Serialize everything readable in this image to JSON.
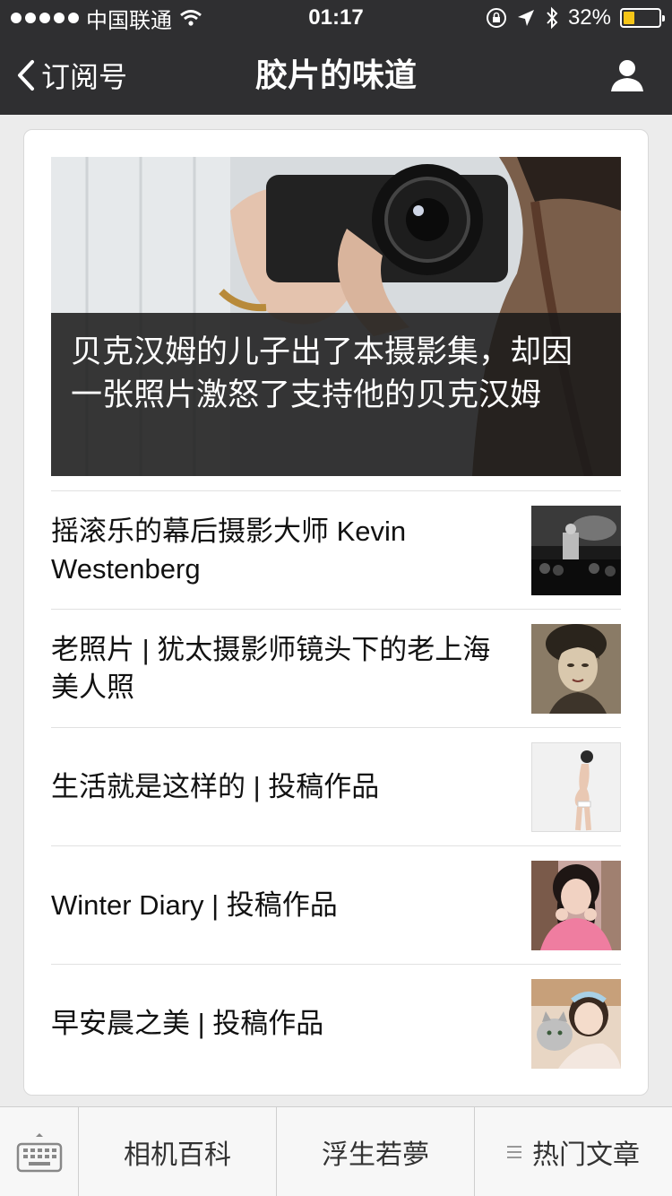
{
  "status_bar": {
    "carrier": "中国联通",
    "time": "01:17",
    "battery": "32%",
    "battery_level": 0.32,
    "icons": [
      "signal-dots-icon",
      "wifi-icon",
      "rotation-lock-icon",
      "location-icon",
      "bluetooth-icon",
      "battery-icon"
    ]
  },
  "nav": {
    "back_label": "订阅号",
    "title": "胶片的味道",
    "user_icon": "user-icon"
  },
  "hero": {
    "title": "贝克汉姆的儿子出了本摄影集，却因一张照片激怒了支持他的贝克汉姆"
  },
  "articles": [
    {
      "title": "摇滚乐的幕后摄影大师 Kevin Westenberg",
      "thumb": "concert-photo"
    },
    {
      "title": "老照片 | 犹太摄影师镜头下的老上海美人照",
      "thumb": "vintage-portrait-photo"
    },
    {
      "title": "生活就是这样的 | 投稿作品",
      "thumb": "pregnant-woman-photo"
    },
    {
      "title": "Winter Diary | 投稿作品",
      "thumb": "girl-pink-sweater-photo"
    },
    {
      "title": "早安晨之美 | 投稿作品",
      "thumb": "girl-with-cat-photo"
    }
  ],
  "bottom_menu": {
    "keyboard_icon": "keyboard-icon",
    "items": [
      "相机百科",
      "浮生若夢",
      "热门文章"
    ]
  },
  "colors": {
    "bar_background": "#2f2f31",
    "page_background": "#ececec",
    "battery_fill": "#f5c518"
  }
}
